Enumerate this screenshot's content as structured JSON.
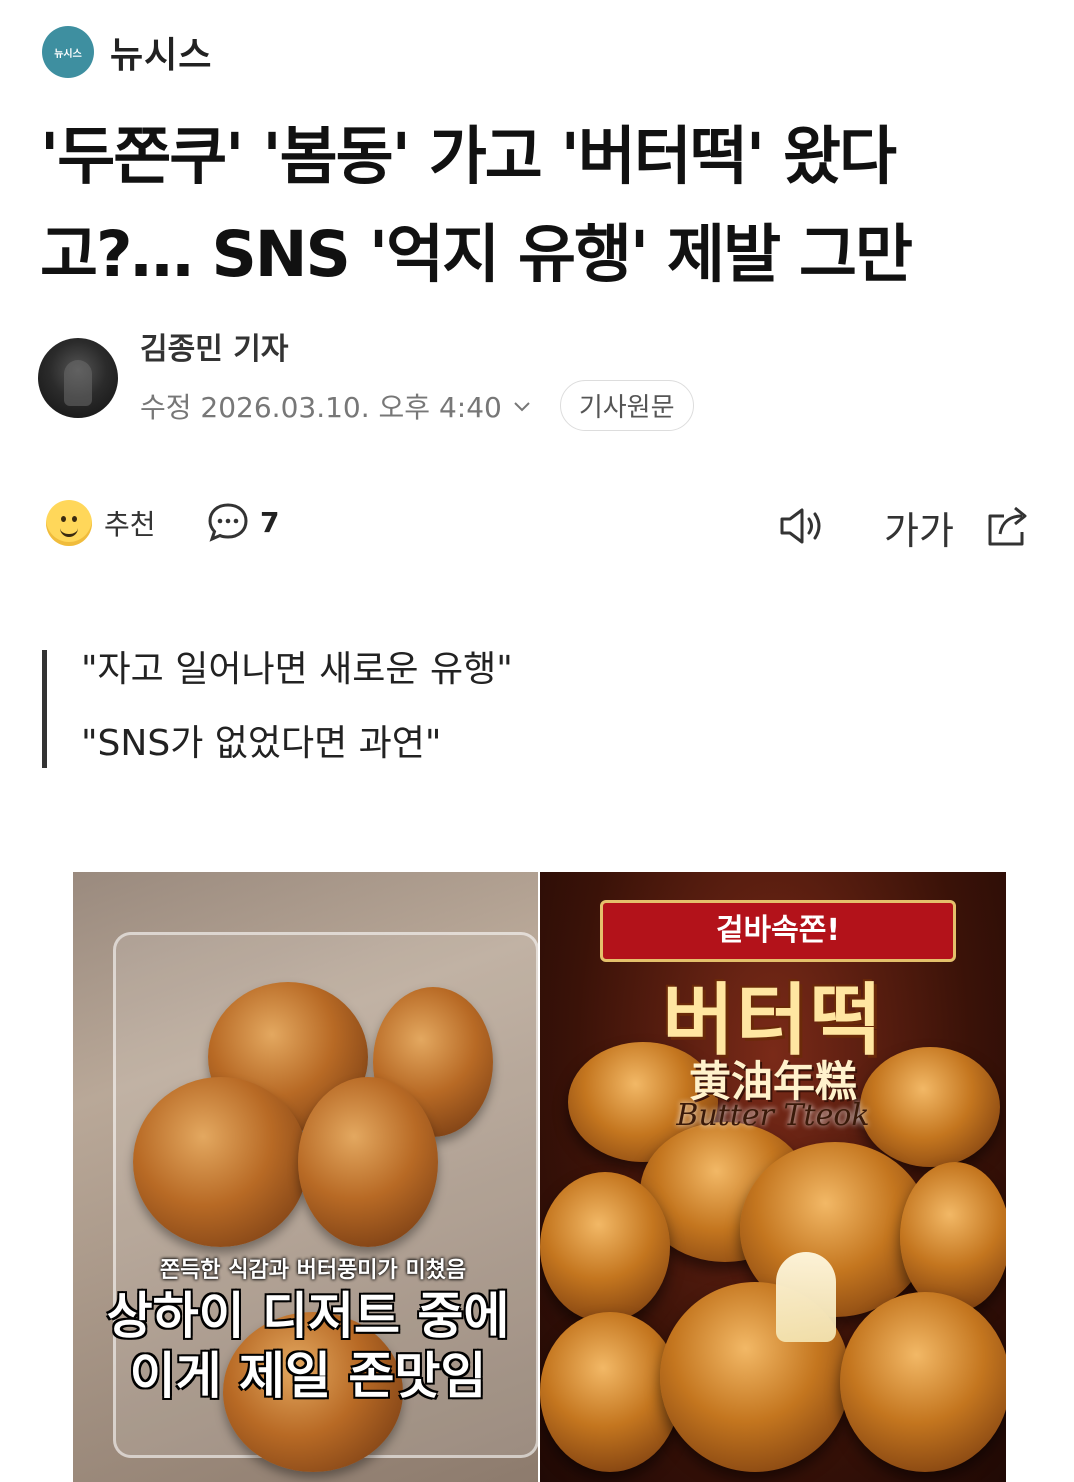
{
  "publisher": {
    "logo_text": "뉴시스",
    "name": "뉴시스"
  },
  "headline": "'두쫀쿠' '봄동' 가고 '버터떡' 왔다고?… SNS '억지 유행' 제발 그만",
  "byline": {
    "reporter": "김종민 기자",
    "date": "수정 2026.03.10. 오후 4:40",
    "original_button": "기사원문"
  },
  "actions": {
    "recommend_label": "추천",
    "comment_count": "7",
    "font_size_label": "가가"
  },
  "quotes": [
    "\"자고 일어나면 새로운 유행\"",
    "\"SNS가 없었다면 과연\""
  ],
  "photo": {
    "left_caption_small": "쫀득한 식감과 버터풍미가 미쳤음",
    "left_caption_big_1": "상하이 디저트 중에",
    "left_caption_big_2": "이게 제일 존맛임",
    "right_ribbon": "겉바속쫀!",
    "right_title": "버터떡",
    "right_title_cn": "黄油年糕",
    "right_title_en": "Butter Tteok"
  },
  "colors": {
    "publisher_logo": "#3e8fa0",
    "emoji": "#ffd75a",
    "quote_bar": "#333333"
  }
}
